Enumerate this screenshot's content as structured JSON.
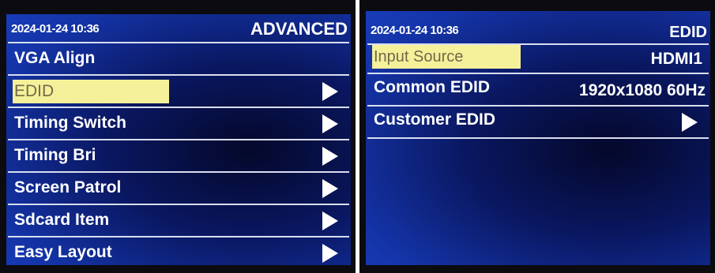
{
  "left_screen": {
    "time": "2024-01-24 10:36",
    "title": "ADVANCED",
    "items": [
      {
        "label": "VGA Align"
      },
      {
        "label": "EDID"
      },
      {
        "label": "Timing Switch"
      },
      {
        "label": "Timing Bri"
      },
      {
        "label": "Screen Patrol"
      },
      {
        "label": "Sdcard Item"
      },
      {
        "label": "Easy Layout"
      }
    ]
  },
  "right_screen": {
    "time": "2024-01-24 10:36",
    "title": "EDID",
    "items": [
      {
        "label": "Input Source",
        "value": "HDMI1"
      },
      {
        "label": "Common EDID",
        "value": "1920x1080 60Hz"
      },
      {
        "label": "Customer EDID"
      }
    ]
  },
  "colors": {
    "background": "#1434a8",
    "highlight": "#f5f09a",
    "text": "#ffffff"
  }
}
